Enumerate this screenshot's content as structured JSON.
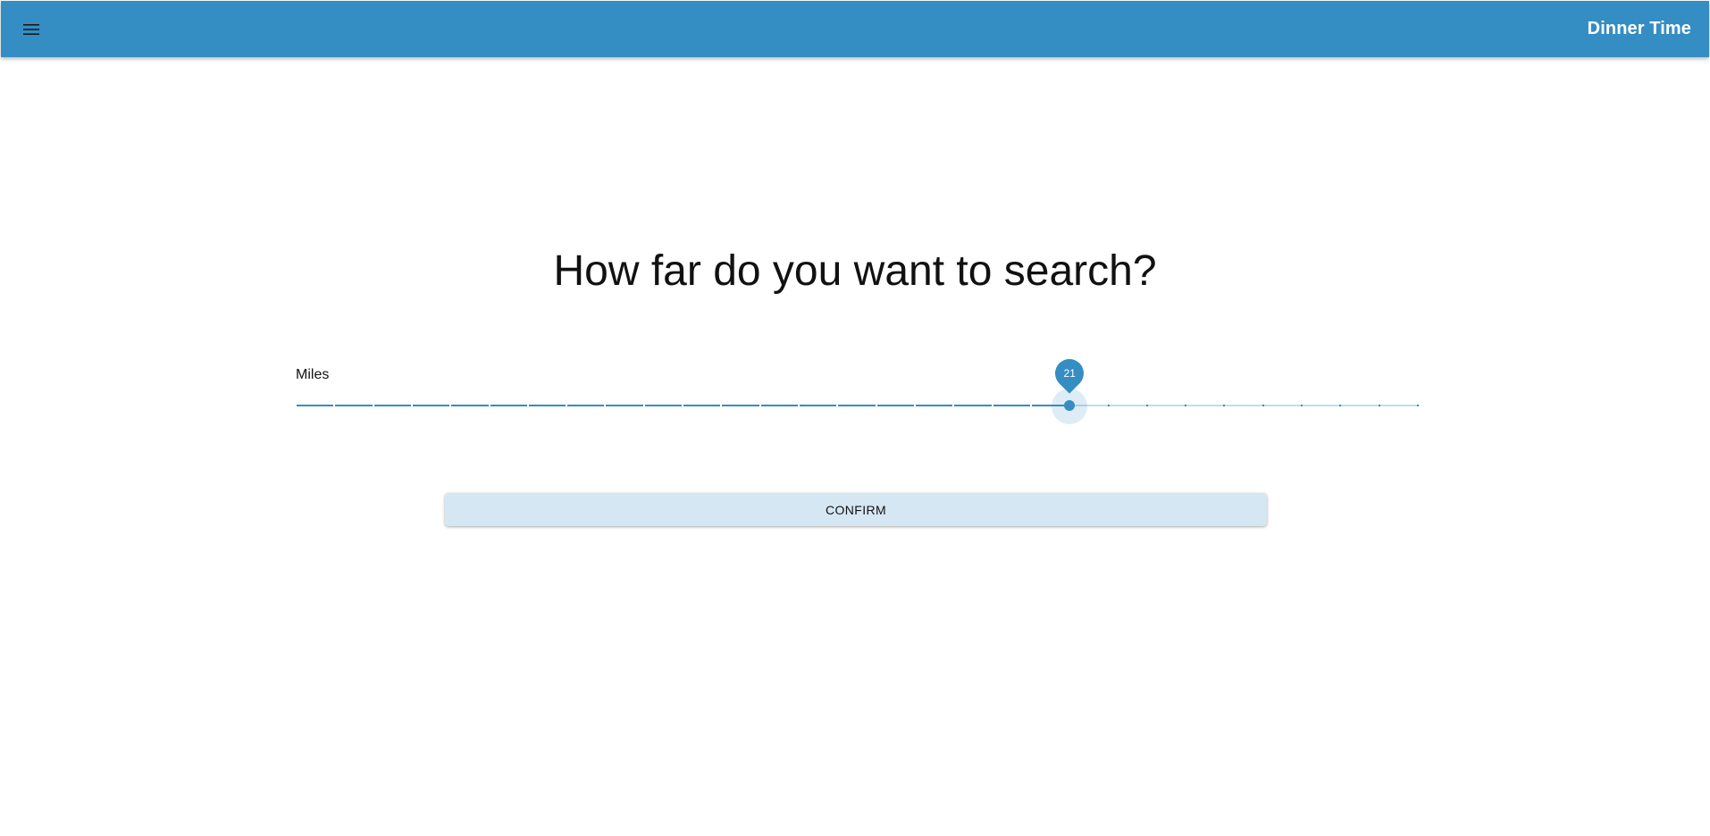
{
  "app": {
    "title": "Dinner Time"
  },
  "header": {
    "menu_icon": "menu-icon"
  },
  "main": {
    "question": "How far do you want to search?",
    "slider": {
      "label": "Miles",
      "value": 21,
      "min": 1,
      "max": 30,
      "value_display": "21"
    },
    "confirm_label": "CONFIRM"
  },
  "colors": {
    "primary": "#348dc3",
    "button_bg": "#d5e7f2",
    "track_inactive": "#c0dcee"
  }
}
